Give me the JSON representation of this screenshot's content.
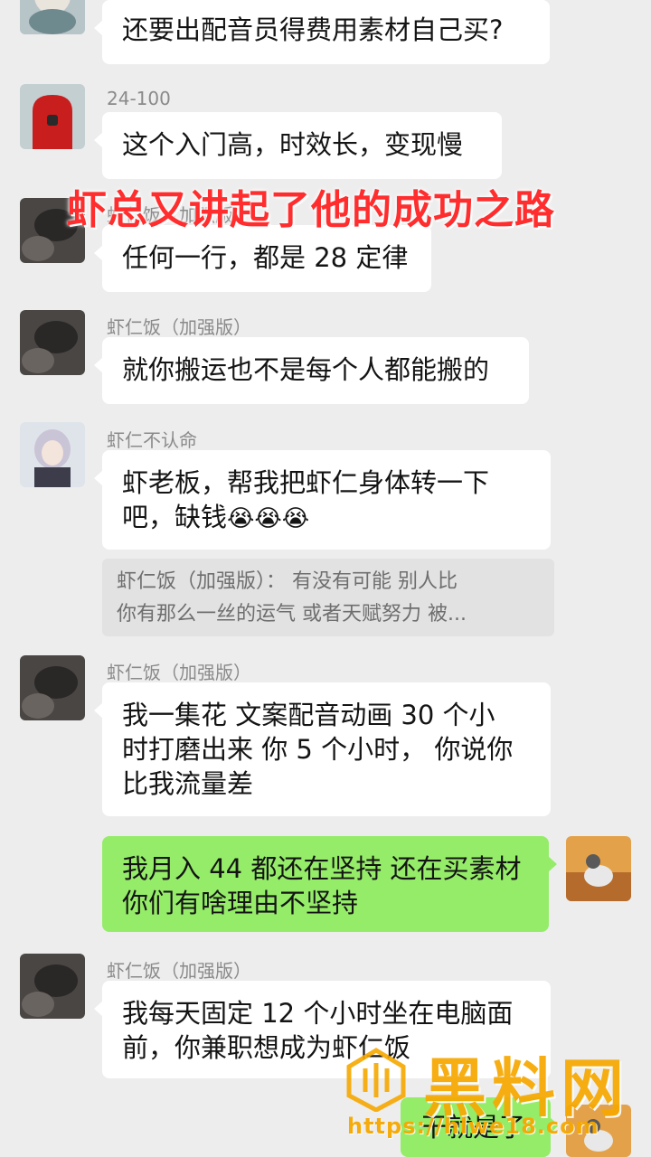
{
  "overlay": {
    "headline": "虾总又讲起了他的成功之路",
    "watermark_text": "黑料网",
    "watermark_url": "https://hlwe18.com"
  },
  "messages": [
    {
      "text": "还要出配音员得费用素材自己买?"
    },
    {
      "sender": "24-100",
      "text": "这个入门高，时效长，变现慢"
    },
    {
      "sender": "虾仁饭（加强版）",
      "text": "任何一行，都是 28 定律"
    },
    {
      "sender": "虾仁饭（加强版）",
      "text": "就你搬运也不是每个人都能搬的"
    },
    {
      "sender": "虾仁不认命",
      "text_line1": "虾老板，帮我把虾仁身体转一下",
      "text_line2": "吧，缺钱",
      "emoji": "😭😭😭"
    },
    {
      "quote_line1": "虾仁饭（加强版）：  有没有可能  别人比",
      "quote_line2": "你有那么一丝的运气 或者天赋努力   被..."
    },
    {
      "sender": "虾仁饭（加强版）",
      "text_line1": "我一集花  文案配音动画  30 个小",
      "text_line2": "时打磨出来    你 5 个小时， 你说你",
      "text_line3": "比我流量差"
    },
    {
      "text_line1": "我月入 44 都还在坚持 还在买素材",
      "text_line2": "你们有啥理由不坚持"
    },
    {
      "sender": "虾仁饭（加强版）",
      "text_line1": "我每天固定 12 个小时坐在电脑面",
      "text_line2": "前，你兼职想成为虾仁饭"
    },
    {
      "text": "干就是了"
    }
  ]
}
